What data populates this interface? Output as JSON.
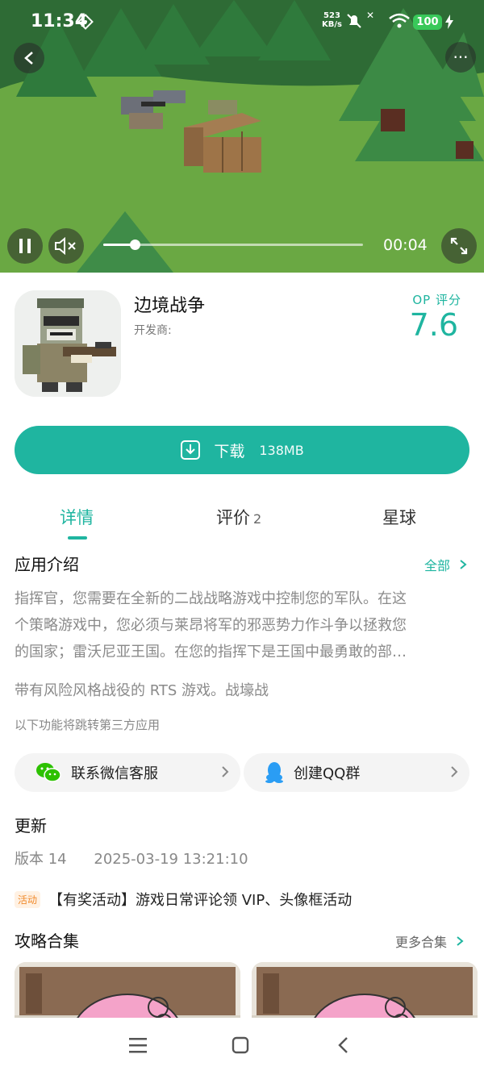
{
  "status_bar": {
    "time": "11:34",
    "net_speed_value": "523",
    "net_speed_unit": "KB/s",
    "battery": "100"
  },
  "video": {
    "elapsed": "00:04",
    "progress_fraction": 0.12
  },
  "app": {
    "name": "边境战争",
    "developer_label": "开发商:",
    "score_label": "OP 评分",
    "score": "7.6"
  },
  "download": {
    "label": "下载",
    "size": "138MB"
  },
  "tabs": [
    {
      "label": "详情",
      "count": ""
    },
    {
      "label": "评价",
      "count": "2"
    },
    {
      "label": "星球",
      "count": ""
    }
  ],
  "intro": {
    "title": "应用介绍",
    "all_label": "全部",
    "lines": [
      "指挥官，您需要在全新的二战战略游戏中控制您的军队。在这",
      "个策略游戏中，您必须与莱昂将军的邪恶势力作斗争以拯救您",
      "的国家；雷沃尼亚王国。在您的指挥下是王国中最勇敢的部…"
    ],
    "tagline": "带有风险风格战役的 RTS 游戏。战壕战",
    "third_party_note": "以下功能将跳转第三方应用"
  },
  "contact": {
    "wechat_label": "联系微信客服",
    "qq_label": "创建QQ群"
  },
  "update": {
    "title": "更新",
    "version": "版本 14",
    "date": "2025-03-19 13:21:10"
  },
  "activity": {
    "badge": "活动",
    "text": "【有奖活动】游戏日常评论领 VIP、头像框活动"
  },
  "guides": {
    "title": "攻略合集",
    "more_label": "更多合集"
  },
  "colors": {
    "accent": "#1fb5a0",
    "wechat": "#2dc100",
    "qq": "#2a9df4",
    "activity": "#f08a2c"
  }
}
